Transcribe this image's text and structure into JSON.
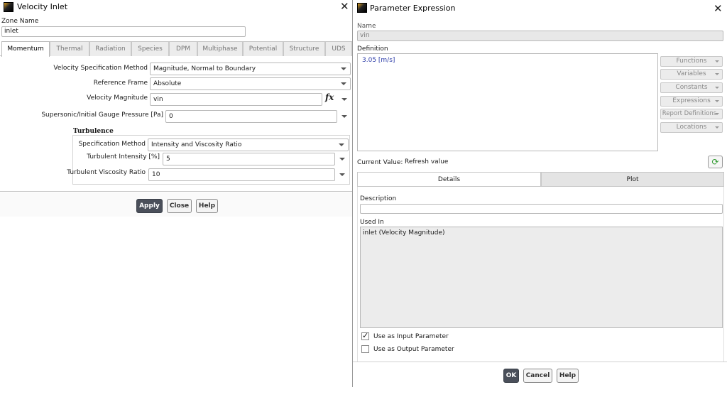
{
  "velocity_inlet": {
    "title": "Velocity Inlet",
    "zone_name_label": "Zone Name",
    "zone_name_value": "inlet",
    "tabs": [
      "Momentum",
      "Thermal",
      "Radiation",
      "Species",
      "DPM",
      "Multiphase",
      "Potential",
      "Structure",
      "UDS"
    ],
    "velocity_spec_label": "Velocity Specification Method",
    "velocity_spec_value": "Magnitude, Normal to Boundary",
    "reference_frame_label": "Reference Frame",
    "reference_frame_value": "Absolute",
    "velocity_magnitude_label": "Velocity Magnitude",
    "velocity_magnitude_value": "vin",
    "fx_icon": "fx",
    "gauge_pressure_label": "Supersonic/Initial Gauge Pressure [Pa]",
    "gauge_pressure_value": "0",
    "turbulence_heading": "Turbulence",
    "turb_spec_label": "Specification Method",
    "turb_spec_value": "Intensity and Viscosity Ratio",
    "turb_intensity_label": "Turbulent Intensity [%]",
    "turb_intensity_value": "5",
    "turb_visc_label": "Turbulent Viscosity Ratio",
    "turb_visc_value": "10",
    "apply_label": "Apply",
    "close_label": "Close",
    "help_label": "Help"
  },
  "parameter_expression": {
    "title": "Parameter Expression",
    "name_label": "Name",
    "name_value": "vin",
    "definition_label": "Definition",
    "definition_value": "3.05 [m/s]",
    "side_buttons": [
      "Functions",
      "Variables",
      "Constants",
      "Expressions",
      "Report Definitions",
      "Locations"
    ],
    "current_value_label": "Current Value:",
    "refresh_label": "Refresh value",
    "tab_details": "Details",
    "tab_plot": "Plot",
    "description_label": "Description",
    "description_value": "",
    "used_in_label": "Used In",
    "used_in_value": "inlet (Velocity Magnitude)",
    "use_input_label": "Use as Input Parameter",
    "use_input_checked": true,
    "use_output_label": "Use as Output Parameter",
    "use_output_checked": false,
    "ok_label": "OK",
    "cancel_label": "Cancel",
    "help_label": "Help"
  },
  "colors": {
    "definition_text": "#2a3aa8",
    "primary_button": "#4a4f5a",
    "refresh_icon": "#2e9a2e"
  }
}
